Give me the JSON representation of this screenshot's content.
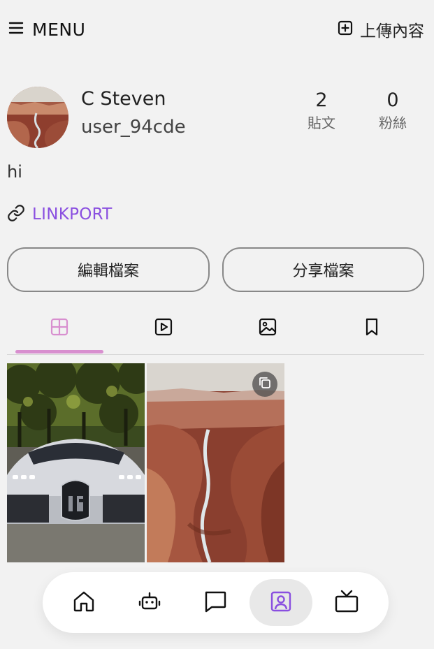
{
  "topbar": {
    "menu_label": "MENU",
    "upload_label": "上傳內容"
  },
  "profile": {
    "display_name": "C Steven",
    "username": "user_94cde",
    "bio": "hi",
    "link_text": "LINKPORT",
    "stats": [
      {
        "value": "2",
        "label": "貼文"
      },
      {
        "value": "0",
        "label": "粉絲"
      }
    ],
    "buttons": {
      "edit": "編輯檔案",
      "share": "分享檔案"
    }
  },
  "tabs": [
    {
      "icon": "grid-icon",
      "active": true
    },
    {
      "icon": "video-play-icon",
      "active": false
    },
    {
      "icon": "image-icon",
      "active": false
    },
    {
      "icon": "bookmark-icon",
      "active": false
    }
  ],
  "posts": [
    {
      "subject": "car-photo",
      "multi": false
    },
    {
      "subject": "canyon-photo",
      "multi": true
    }
  ],
  "bottom_nav": [
    {
      "icon": "home-icon",
      "active": false
    },
    {
      "icon": "robot-icon",
      "active": false
    },
    {
      "icon": "chat-icon",
      "active": false
    },
    {
      "icon": "profile-icon",
      "active": true
    },
    {
      "icon": "tv-icon",
      "active": false
    }
  ],
  "colors": {
    "accent": "#8a4fe0",
    "tab_active": "#d88fcf",
    "background": "#f2f2f2"
  }
}
